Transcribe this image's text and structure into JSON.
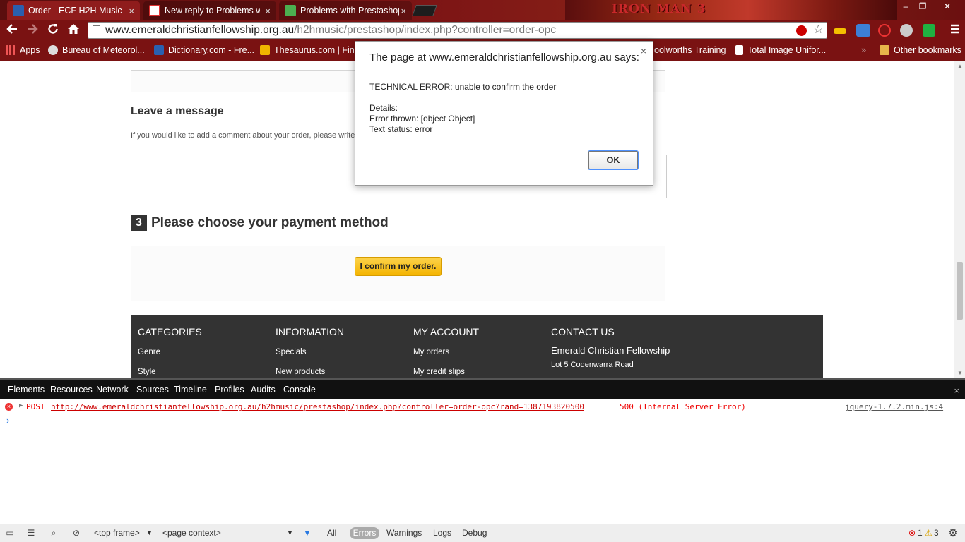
{
  "browser": {
    "tabs": [
      {
        "title": "Order - ECF H2H Music",
        "close": "×"
      },
      {
        "title": "New reply to Problems wi",
        "close": "×"
      },
      {
        "title": "Problems with Prestashop",
        "close": "×"
      }
    ],
    "banner_text": "IRON MAN 3",
    "window_controls": [
      "–",
      "❐",
      "✕"
    ],
    "url_host": "www.emeraldchristianfellowship.org.au",
    "url_path": "/h2hmusic/prestashop/index.php?controller=order-opc",
    "bookmarks": [
      "Apps",
      "Bureau of Meteorol...",
      "Dictionary.com - Fre...",
      "Thesaurus.com | Fin...",
      "oolworths Training",
      "Total Image Unifor..."
    ],
    "bookmarks_overflow": "»",
    "other_bookmarks": "Other bookmarks"
  },
  "page": {
    "leave_message_title": "Leave a message",
    "leave_message_hint": "If you would like to add a comment about your order, please write",
    "step_number": "3",
    "payment_title": "Please choose your payment method",
    "confirm_button": "I confirm my order.",
    "footer": {
      "categories_heading": "CATEGORIES",
      "categories": [
        "Genre",
        "Style"
      ],
      "information_heading": "INFORMATION",
      "information": [
        "Specials",
        "New products"
      ],
      "account_heading": "MY ACCOUNT",
      "account": [
        "My orders",
        "My credit slips"
      ],
      "contact_heading": "CONTACT US",
      "contact_name": "Emerald Christian Fellowship",
      "contact_address": "Lot 5 Codenwarra Road"
    }
  },
  "dialog": {
    "title": "The page at www.emeraldchristianfellowship.org.au says:",
    "close": "×",
    "line1": "TECHNICAL ERROR: unable to confirm the order",
    "line2": "Details:",
    "line3": "Error thrown: [object Object]",
    "line4": "Text status: error",
    "ok": "OK"
  },
  "devtools": {
    "tabs": [
      "Elements",
      "Resources",
      "Network",
      "Sources",
      "Timeline",
      "Profiles",
      "Audits",
      "Console"
    ],
    "close": "×",
    "error": {
      "method": "POST",
      "url": "http://www.emeraldchristianfellowship.org.au/h2hmusic/prestashop/index.php?controller=order-opc?rand=1387193820500",
      "status": "500 (Internal Server Error)",
      "source": "jquery-1.7.2.min.js:4"
    },
    "prompt": "›",
    "frame_select": "<top frame>",
    "context_select": "<page context>",
    "filters": [
      "All",
      "Errors",
      "Warnings",
      "Logs",
      "Debug"
    ],
    "error_count": "1",
    "warning_count": "3",
    "colors": {
      "error": "#e00000",
      "accent": "#2a7ae2"
    }
  }
}
